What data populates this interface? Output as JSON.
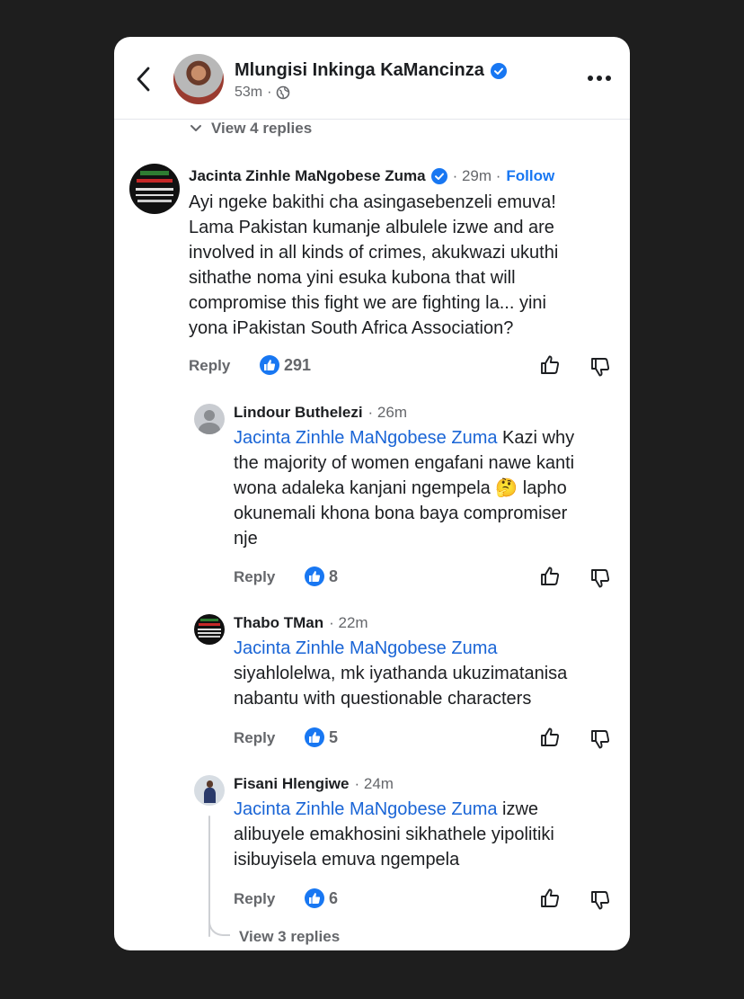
{
  "header": {
    "author": "Mlungisi Inkinga KaMancinza",
    "time": "53m",
    "separator": "·"
  },
  "view_replies_top": "View 4 replies",
  "comments": [
    {
      "name": "Jacinta Zinhle MaNgobese Zuma",
      "time": "· 29m ·",
      "follow": "Follow",
      "text_lines": [
        "Ayi ngeke bakithi cha asingasebenzeli emuva!",
        "Lama Pakistan kumanje albulele izwe and are",
        "involved in all kinds of crimes, akukwazi ukuthi",
        "sithathe noma yini esuka kubona that will",
        "compromise this fight we are fighting la... yini",
        "yona iPakistan South Africa Association?"
      ],
      "reply": "Reply",
      "likes": "291"
    },
    {
      "name": "Lindour Buthelezi",
      "time": "· 26m",
      "mention": "Jacinta Zinhle MaNgobese Zuma",
      "first_rest": " Kazi why",
      "text_lines": [
        "the majority of women engafani nawe kanti",
        "wona adaleka kanjani ngempela 🤔 lapho",
        "okunemali khona bona baya compromiser",
        "nje"
      ],
      "reply": "Reply",
      "likes": "8"
    },
    {
      "name": "Thabo TMan",
      "time": "· 22m",
      "mention": "Jacinta Zinhle MaNgobese Zuma",
      "text_lines": [
        "siyahlolelwa, mk iyathanda ukuzimatanisa",
        "nabantu with questionable characters"
      ],
      "reply": "Reply",
      "likes": "5"
    },
    {
      "name": "Fisani Hlengiwe",
      "time": "· 24m",
      "mention": "Jacinta Zinhle MaNgobese Zuma",
      "first_rest": " izwe",
      "text_lines": [
        "alibuyele emakhosini sikhathele yipolitiki",
        "isibuyisela emuva ngempela"
      ],
      "reply": "Reply",
      "likes": "6"
    }
  ],
  "view_replies_bottom": "View 3 replies",
  "colors": {
    "background": "#1e1e1e",
    "card": "#ffffff",
    "accent": "#1877f2",
    "mention": "#1a65d6",
    "secondary_text": "#65676b"
  }
}
